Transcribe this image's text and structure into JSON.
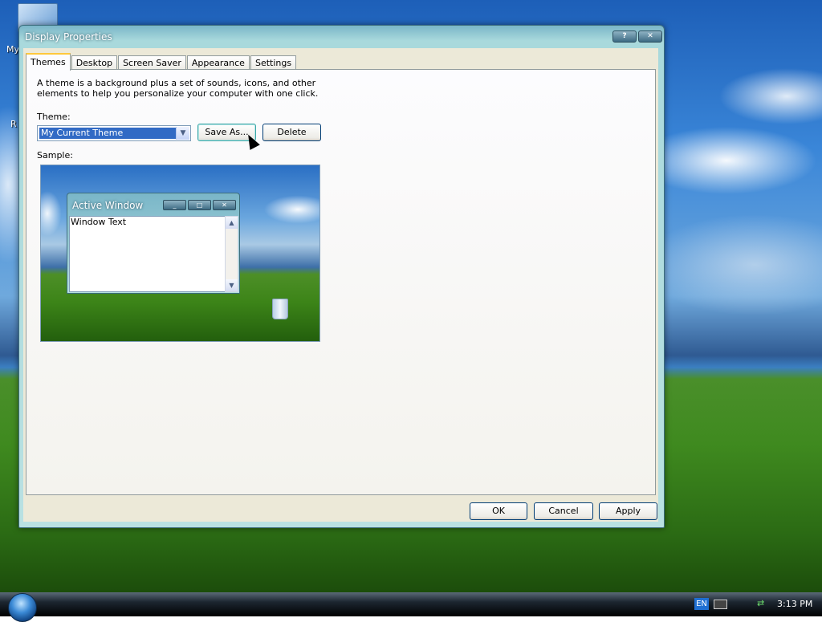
{
  "desktop": {
    "icon_labels": [
      "My",
      "R"
    ]
  },
  "window": {
    "title": "Display Properties",
    "help_button": "?",
    "close_button": "✕"
  },
  "tabs": [
    "Themes",
    "Desktop",
    "Screen Saver",
    "Appearance",
    "Settings"
  ],
  "themes_tab": {
    "description": "A theme is a background plus a set of sounds, icons, and other elements to help you personalize your computer with one click.",
    "theme_label": "Theme:",
    "theme_value": "My Current Theme",
    "save_as_label": "Save As...",
    "delete_label": "Delete",
    "sample_label": "Sample:"
  },
  "sample_preview": {
    "window_title": "Active Window",
    "window_text": "Window Text"
  },
  "footer": {
    "ok_label": "OK",
    "cancel_label": "Cancel",
    "apply_label": "Apply"
  },
  "taskbar": {
    "language": "EN",
    "clock": "3:13 PM"
  }
}
